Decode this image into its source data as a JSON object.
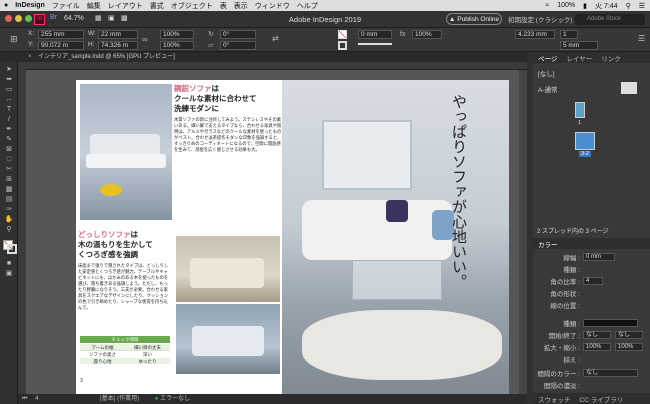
{
  "menubar": {
    "app": "InDesign",
    "items": [
      "ファイル",
      "編集",
      "レイアウト",
      "書式",
      "オブジェクト",
      "表",
      "表示",
      "ウィンドウ",
      "ヘルプ"
    ],
    "battery": "100%",
    "clock": "火 7:44"
  },
  "appbar": {
    "zoom": "64.7%",
    "title": "Adobe InDesign 2019",
    "publish": "Publish Online",
    "workspace": "初期設定 (クラシック)",
    "search_placeholder": "Adobe Stock"
  },
  "control": {
    "x": "255 mm",
    "y": "90.072 m",
    "w": "22 mm",
    "h": "74.326 m",
    "scale_x": "100%",
    "scale_y": "100%",
    "rot": "0°",
    "shear": "0°",
    "stroke": "0 mm",
    "opacity": "100%",
    "corner": "4.233 mm",
    "gap": "5 mm",
    "flag": "1"
  },
  "doc_tab": "インテリア_sample.indd @ 65% [GPU プレビュー]",
  "status": {
    "page": "4",
    "master": "[基本] (作業用)",
    "errors": "エラーなし"
  },
  "panel": {
    "tabs": [
      "ページ",
      "レイヤー",
      "リンク"
    ],
    "none": "[なし]",
    "master": "A-通常",
    "page1": "1",
    "spread": "3-2",
    "spread_info": "2 スプレッド内の 3 ページ",
    "color_title": "カラー",
    "stroke_label": "線幅 :",
    "stroke_value": "0 mm",
    "type_label": "種類 :",
    "miter_label": "角の比率 :",
    "miter_value": "4",
    "corner_label": "角の形状 :",
    "align_label": "線の位置 :",
    "type2_label": "種類 :",
    "start_label": "開始/終了 :",
    "start_value": "なし",
    "end_value": "なし",
    "scale_label": "拡大・縮小 :",
    "scale_a": "100%",
    "scale_b": "100%",
    "align2_label": "揃え :",
    "gapcolor_label": "間隔のカラー :",
    "gapcolor_value": "なし",
    "gaptint_label": "間隔の濃淡 :",
    "bottom_tabs": [
      "スウォッチ",
      "CC ライブラリ"
    ]
  },
  "spread": {
    "left": {
      "h1_accent": "鋼鋭ソファ",
      "h1_rest": "は",
      "h1_line2": "クールな素材に合わせて",
      "h1_line3": "洗練モダンに",
      "body1": "木質ソファの新に注目してみよう。ステンレスやその素いある。細い脚で支えるタイプなら、合わせる家具や照明は、アルミやガラスなどのクールな素材を使ったものがベスト。合わせ淡茶提作モダンな印象を強調すると、すっきりめのコーディネートになるので、空間に開放感を生みて、部屋を広く感じさせる効果も大。",
      "h2_accent": "どっしりソファ",
      "h2_rest": "は",
      "h2_line2": "木の温もりを生かして",
      "h2_line3": "くつろぎ感を強調",
      "body2": "床面まで張りで隠されたタイプは、どっしりした安定感とくつろぎ感が魅力。テーブルやキャビネットにも、ほかみのある木を使ったものを選び、落ち着きある強調しよう。ただし、もったり野暮になりそう。工夫が必要。合わせる家具をスクエアなデザインにしたり、クッションの色で引き締めたり、シャープな感覚を持ち込んで。",
      "table_title": "チェック項目",
      "table_rows": [
        [
          "アームの幅",
          "細い目の丈夫"
        ],
        [
          "ソファの奥さ",
          "深い"
        ],
        [
          "座り心地",
          "ゆったり"
        ]
      ],
      "page_num": "3"
    },
    "right": {
      "heading_line1": "やっぱりソファが",
      "heading_line2": "心地いい。"
    }
  }
}
